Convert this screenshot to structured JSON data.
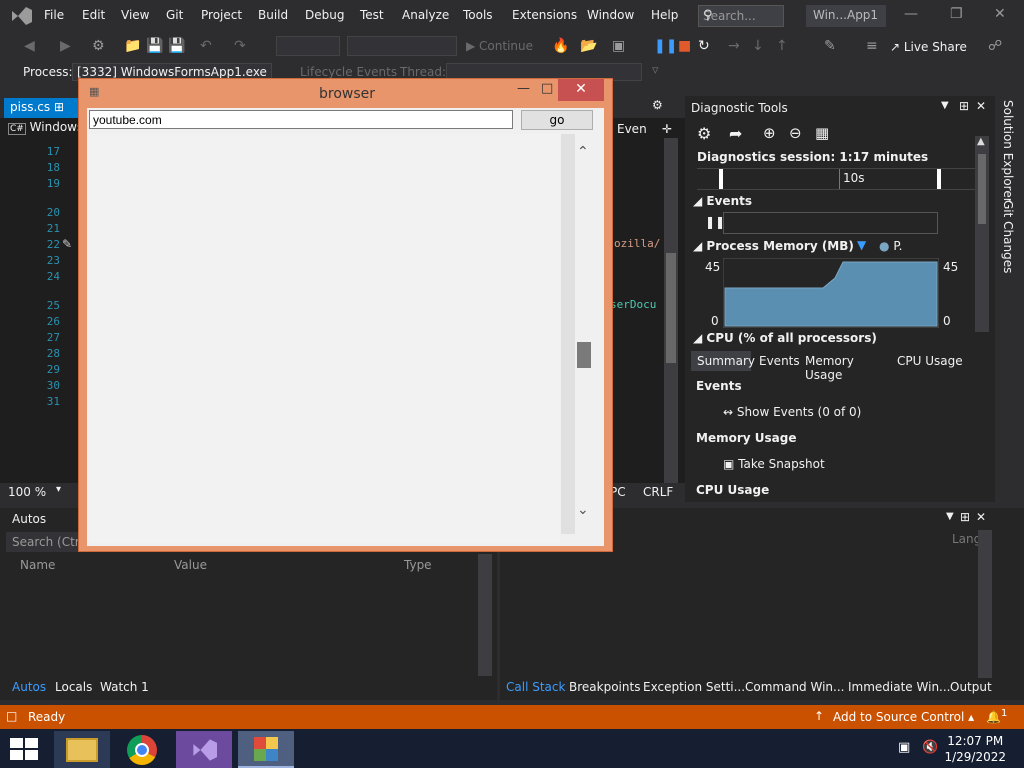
{
  "menu": {
    "items": [
      "File",
      "Edit",
      "View",
      "Git",
      "Project",
      "Build",
      "Debug",
      "Test",
      "Analyze",
      "Tools",
      "Extensions",
      "Window",
      "Help"
    ],
    "search_placeholder": "Search...",
    "title": "Win...App1"
  },
  "toolbar": {
    "continue_label": "Continue",
    "live_share_label": "Live Share",
    "process_label": "Process:",
    "process_value": "[3332] WindowsFormsApp1.exe",
    "lifecycle_label": "Lifecycle Events",
    "thread_label": "Thread:"
  },
  "editor": {
    "tab_name": "piss.cs",
    "file_tab": "Windows",
    "line_numbers": [
      "17",
      "18",
      "19",
      "20",
      "21",
      "22",
      "23",
      "24",
      "25",
      "26",
      "27",
      "28",
      "29",
      "30",
      "31"
    ],
    "code_fragment_1": "ozilla/",
    "code_fragment_2": "serDocu",
    "right_label": "Even",
    "zoom": "100 %",
    "status_pc": "PC",
    "status_crlf": "CRLF"
  },
  "browser": {
    "title": "browser",
    "url": "youtube.com",
    "go_label": "go"
  },
  "diagnostics": {
    "title": "Diagnostic Tools",
    "session": "Diagnostics session: 1:17 minutes",
    "timeline_label": "10s",
    "events_label": "Events",
    "memory_label": "Process Memory (MB)",
    "memory_legend": "P.",
    "mem_max": "45",
    "mem_min": "0",
    "cpu_label": "CPU (% of all processors)",
    "tabs": [
      "Summary",
      "Events",
      "Memory Usage",
      "CPU Usage"
    ],
    "summary_events_header": "Events",
    "show_events": "Show Events (0 of 0)",
    "memory_usage_header": "Memory Usage",
    "take_snapshot": "Take Snapshot",
    "cpu_usage_header": "CPU Usage"
  },
  "side_tabs": [
    "Solution Explorer",
    "Git Changes"
  ],
  "autos": {
    "title": "Autos",
    "search_placeholder": "Search (Ctrl+",
    "columns": [
      "Name",
      "Value",
      "Type"
    ],
    "tabs": [
      "Autos",
      "Locals",
      "Watch 1"
    ]
  },
  "callstack": {
    "lang_header": "Lang",
    "tabs": [
      "Call Stack",
      "Breakpoints",
      "Exception Setti...",
      "Command Win...",
      "Immediate Win...",
      "Output"
    ]
  },
  "status": {
    "ready": "Ready",
    "add_source": "Add to Source Control",
    "notif_count": "1"
  },
  "taskbar": {
    "time": "12:07 PM",
    "date": "1/29/2022"
  },
  "colors": {
    "accent": "#007acc",
    "statusbar": "#ca5100",
    "browser_frame": "#e8956b",
    "close_red": "#c75050"
  }
}
